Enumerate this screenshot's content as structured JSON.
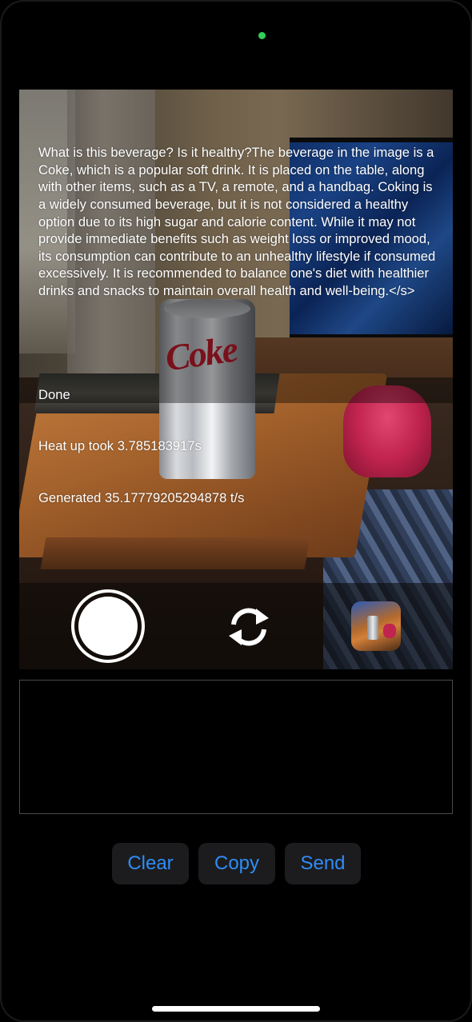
{
  "output": {
    "response": "What is this beverage? Is it healthy?The beverage in the image is a Coke, which is a popular soft drink. It is placed on the table, along with other items, such as a TV, a remote, and a handbag. Coking is a widely consumed beverage, but it is not considered a healthy option due to its high sugar and calorie content. While it may not provide immediate benefits such as weight loss or improved mood, its consumption can contribute to an unhealthy lifestyle if consumed excessively. It is recommended to balance one's diet with healthier drinks and snacks to maintain overall health and well-being.</s>",
    "status": "Done",
    "heat_up": "Heat up took 3.785183917s",
    "generated": "Generated 35.17779205294878 t/s"
  },
  "scene": {
    "can_logo": "Coke"
  },
  "controls": {
    "shutter_icon": "shutter-icon",
    "flip_icon": "flip-camera-icon",
    "thumbnail_icon": "photo-thumbnail-icon"
  },
  "prompt": {
    "value": "",
    "placeholder": ""
  },
  "actions": {
    "clear_label": "Clear",
    "copy_label": "Copy",
    "send_label": "Send"
  },
  "colors": {
    "accent": "#2f8cf6",
    "button_bg": "#1c1c1e",
    "privacy_indicator": "#2fd158"
  }
}
